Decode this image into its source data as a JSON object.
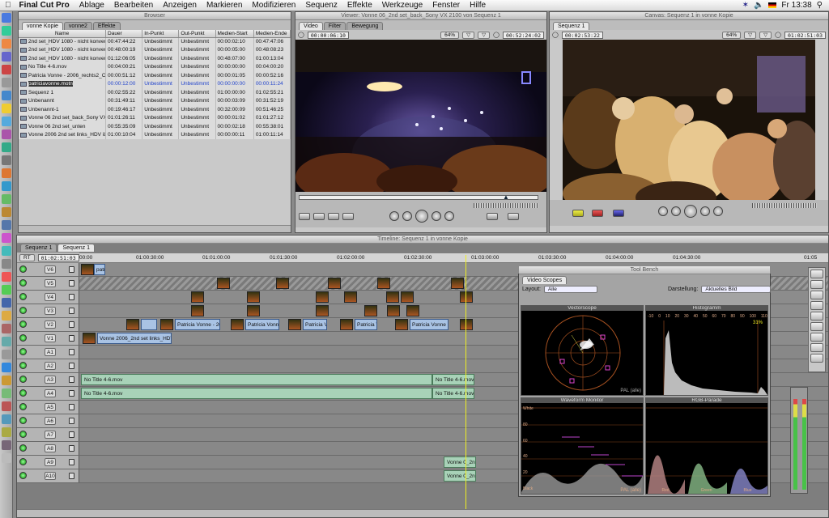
{
  "menubar": {
    "app": "Final Cut Pro",
    "items": [
      "Ablage",
      "Bearbeiten",
      "Anzeigen",
      "Markieren",
      "Modifizieren",
      "Sequenz",
      "Effekte",
      "Werkzeuge",
      "Fenster",
      "Hilfe"
    ],
    "clock": "Fr 13:38"
  },
  "browser": {
    "title": "Browser",
    "tabs": [
      "vonne Kopie",
      "vonne2",
      "Effekte"
    ],
    "columns": [
      "Name",
      "Dauer",
      "In-Punkt",
      "Out-Punkt",
      "Medien-Start",
      "Medien-Ende"
    ],
    "rows": [
      [
        "2nd set_HDV 1080 - nicht konvertie",
        "00:47:44:22",
        "Unbestimmt",
        "Unbestimmt",
        "00:00:02:10",
        "00:47:47:06"
      ],
      [
        "2nd set_HDV 1080 - nicht konvertie",
        "00:48:00:19",
        "Unbestimmt",
        "Unbestimmt",
        "00:00:05:00",
        "00:48:08:23"
      ],
      [
        "2nd set_HDV 1080 - nicht konvertie",
        "01:12:06:05",
        "Unbestimmt",
        "Unbestimmt",
        "00:48:07:00",
        "01:00:13:04"
      ],
      [
        "No Title 4-6.mov",
        "00:04:00:21",
        "Unbestimmt",
        "Unbestimmt",
        "00:00:00:00",
        "00:04:00:20"
      ],
      [
        "Patricia Vonne - 2006_rechts2_Canon",
        "00:00:51:12",
        "Unbestimmt",
        "Unbestimmt",
        "00:00:01:05",
        "00:00:52:16"
      ],
      [
        "patriciavonne.motn",
        "00:00:12:00",
        "Unbestimmt",
        "Unbestimmt",
        "00:00:00:00",
        "00:00:11:24"
      ],
      [
        "Sequenz 1",
        "00:02:55:22",
        "Unbestimmt",
        "Unbestimmt",
        "01:00:00:00",
        "01:02:55:21"
      ],
      [
        "Unbenannt",
        "00:31:49:11",
        "Unbestimmt",
        "Unbestimmt",
        "00:00:03:09",
        "00:31:52:19"
      ],
      [
        "Unbenannt-1",
        "00:19:46:17",
        "Unbestimmt",
        "Unbestimmt",
        "00:32:00:09",
        "00:51:46:25"
      ],
      [
        "Vonne 06 2nd set_back_Sony VX 21",
        "01:01:26:11",
        "Unbestimmt",
        "Unbestimmt",
        "00:00:01:02",
        "01:01:27:12"
      ],
      [
        "Vonne 06 2nd set_unten",
        "00:55:35:09",
        "Unbestimmt",
        "Unbestimmt",
        "00:00:02:18",
        "00:55:38:01"
      ],
      [
        "Vonne 2006 2nd set links_HDV iLin",
        "01:00:10:04",
        "Unbestimmt",
        "Unbestimmt",
        "00:00:00:11",
        "01:00:11:14"
      ]
    ],
    "selected_row": 5
  },
  "viewer": {
    "title": "Viewer: Vonne 06_2nd set_back_Sony VX 2100 von Sequenz 1",
    "tabs": [
      "Video",
      "Filter",
      "Bewegung"
    ],
    "timecode_left": "00:00:06:10",
    "zoom": "64%",
    "timecode_right": "00:52:24:02"
  },
  "canvas": {
    "title": "Canvas: Sequenz 1 in vonne Kopie",
    "tabs": [
      "Sequenz 1"
    ],
    "timecode_left": "00:02:53:22",
    "zoom": "64%",
    "timecode_right": "01:02:51:03"
  },
  "timeline": {
    "title": "Timeline: Sequenz 1 in vonne Kopie",
    "tabs": [
      "Sequenz 1",
      "Sequenz 1"
    ],
    "rt": "RT",
    "timecode": "01:02:51:03",
    "ruler": [
      "00:00",
      "01:00:30:00",
      "01:01:00:00",
      "01:01:30:00",
      "01:02:00:00",
      "01:02:30:00",
      "01:03:00:00",
      "01:03:30:00",
      "01:04:00:00",
      "01:04:30:00",
      "01:05"
    ],
    "video_tracks": [
      "V6",
      "V5",
      "V4",
      "V3",
      "V2",
      "V1"
    ],
    "audio_tracks": [
      "A1",
      "A2",
      "A3",
      "A4",
      "A5",
      "A6",
      "A7",
      "A8",
      "A9",
      "A10"
    ],
    "v6_clip": "patri",
    "v2_clips": [
      "Patricia Vonne - 20",
      "Patricia Vonn",
      "Patricia Vo",
      "Patricia V",
      "Patricia Vonne -"
    ],
    "v1_clip": "Vonne 2006_2nd set links_HDV iLin",
    "a3_clip": "No Title 4-6.mov",
    "a3_clip_b": "No Title 4-6.mov",
    "a4_clip": "No Title 4-6.mov",
    "a4_clip_b": "No Title 4-6.mov",
    "a9_clip": "Vonne 0_2n",
    "a10_clip": "Vonne 0_2n",
    "v1_src": "v1"
  },
  "toolbench": {
    "title": "Tool Bench",
    "tab": "Video Scopes",
    "layout_label": "Layout:",
    "layout_value": "Alle",
    "display_label": "Darstellung:",
    "display_value": "Aktuelles Bild",
    "vectorscope": "Vectorscope",
    "histogram": "Histogramm",
    "waveform": "Waveform Monitor",
    "rgb_parade": "RGB-Parade",
    "pal_label": "PAL (alle)",
    "wf_ticks": [
      "White",
      "80",
      "60",
      "40",
      "20",
      "Black"
    ],
    "hist_ticks": [
      "-10",
      "0",
      "10",
      "20",
      "30",
      "40",
      "50",
      "60",
      "70",
      "80",
      "90",
      "100",
      "110"
    ],
    "parade_labels": [
      "Red",
      "Green",
      "Blue"
    ],
    "percent": "31%"
  },
  "colors": {
    "accent_blue": "#2244cc",
    "clip_video": "#a9c3e4",
    "clip_audio": "#a8d2b8",
    "track_bg": "#8c8c8c"
  }
}
